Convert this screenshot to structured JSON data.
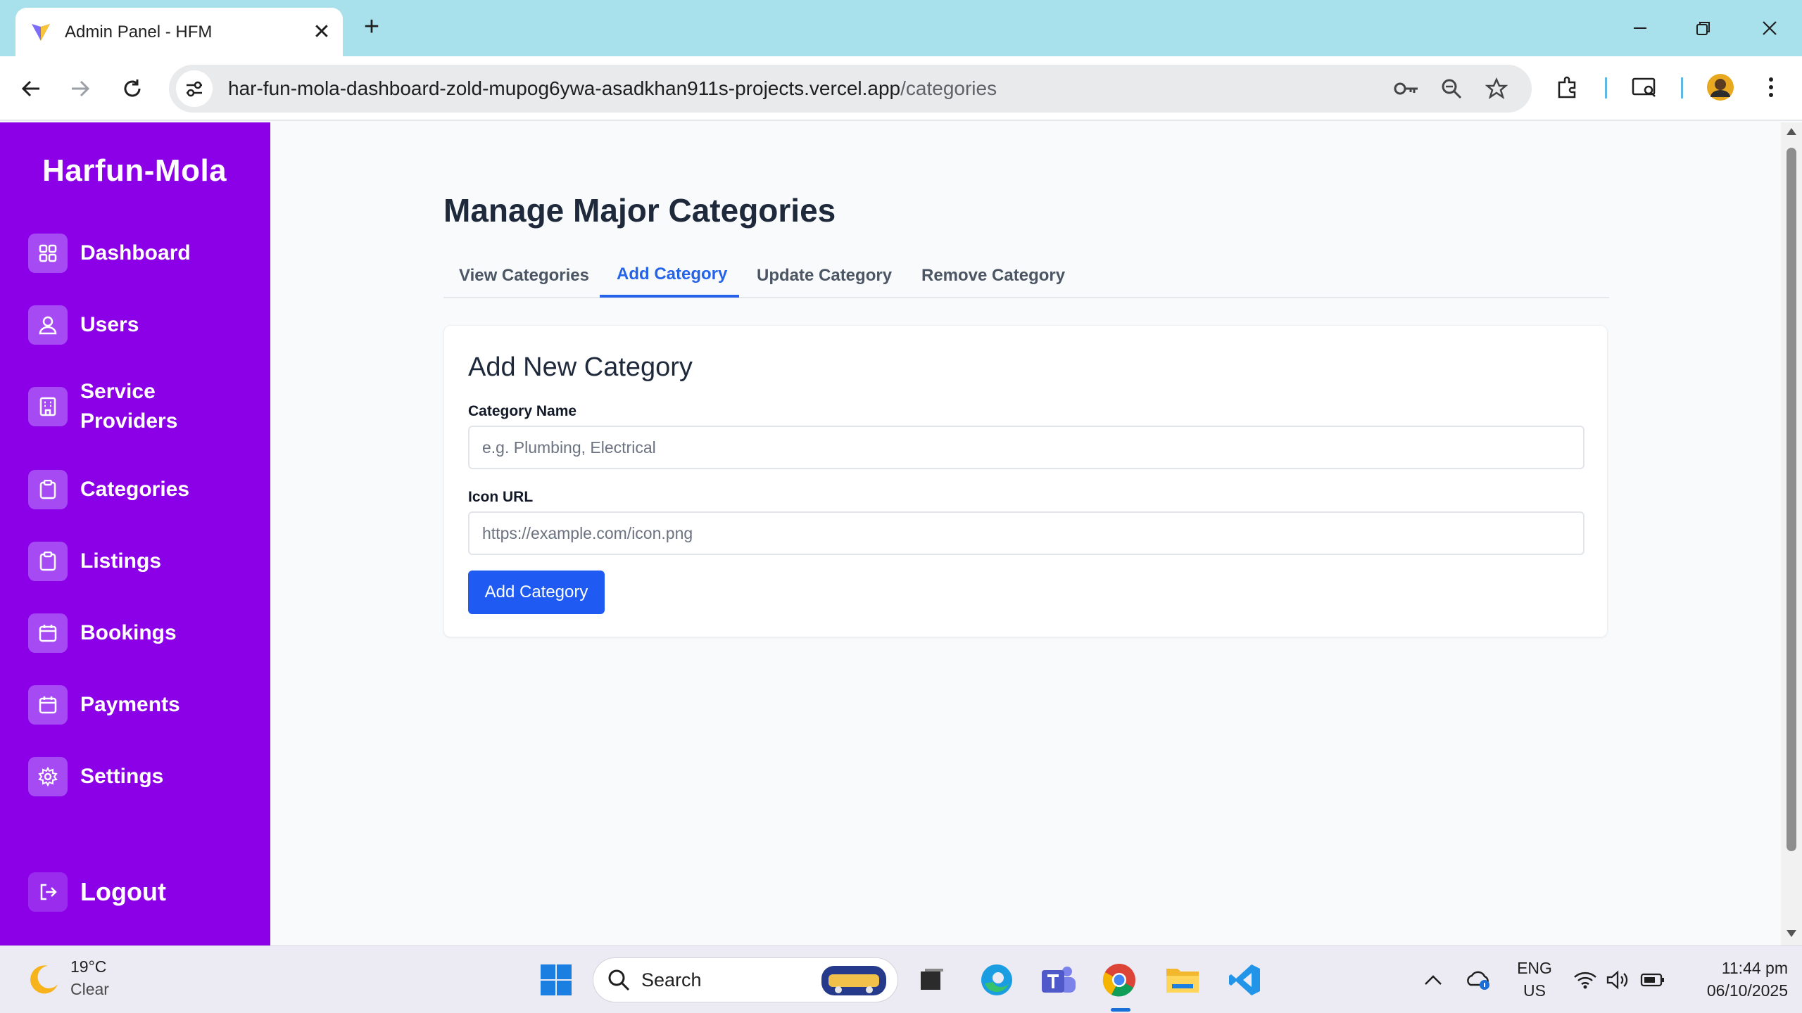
{
  "browser": {
    "tab_title": "Admin Panel - HFM",
    "url_host": "har-fun-mola-dashboard-zold-mupog6ywa-asadkhan911s-projects.vercel.app",
    "url_path": "/categories"
  },
  "sidebar": {
    "brand": "Harfun-Mola",
    "items": [
      {
        "label": "Dashboard",
        "icon": "grid-icon"
      },
      {
        "label": "Users",
        "icon": "users-icon"
      },
      {
        "label": "Service Providers",
        "icon": "building-icon"
      },
      {
        "label": "Categories",
        "icon": "clipboard-icon"
      },
      {
        "label": "Listings",
        "icon": "clipboard-icon"
      },
      {
        "label": "Bookings",
        "icon": "calendar-icon"
      },
      {
        "label": "Payments",
        "icon": "calendar-icon"
      },
      {
        "label": "Settings",
        "icon": "gear-icon"
      }
    ],
    "logout_label": "Logout",
    "colors": {
      "background": "#8b00e6",
      "icon_bg": "#a64bf4"
    }
  },
  "main": {
    "title": "Manage Major Categories",
    "tabs": [
      {
        "label": "View Categories",
        "active": false
      },
      {
        "label": "Add Category",
        "active": true
      },
      {
        "label": "Update Category",
        "active": false
      },
      {
        "label": "Remove Category",
        "active": false
      }
    ],
    "form": {
      "heading": "Add New Category",
      "name_label": "Category Name",
      "name_placeholder": "e.g. Plumbing, Electrical",
      "name_value": "",
      "icon_label": "Icon URL",
      "icon_placeholder": "https://example.com/icon.png",
      "icon_value": "",
      "submit_label": "Add Category"
    },
    "colors": {
      "accent": "#2563eb",
      "button": "#1f5bf2"
    }
  },
  "taskbar": {
    "weather_temp": "19°C",
    "weather_desc": "Clear",
    "search_label": "Search",
    "lang_line1": "ENG",
    "lang_line2": "US",
    "time": "11:44 pm",
    "date": "06/10/2025"
  }
}
